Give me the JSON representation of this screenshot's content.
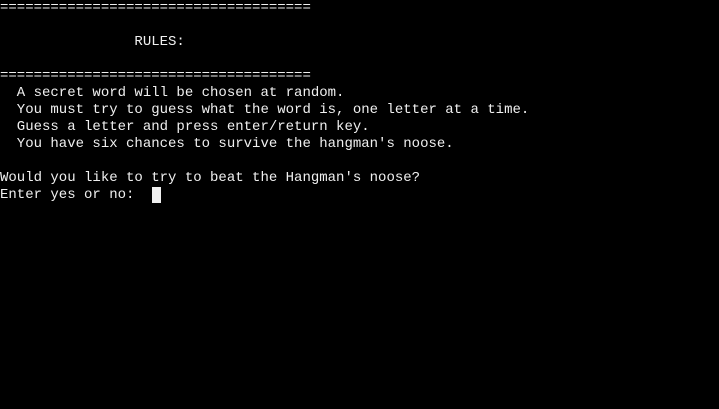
{
  "terminal": {
    "top_rule": "=====================================",
    "heading": "                RULES:",
    "bottom_rule": "=====================================",
    "rules": [
      "  A secret word will be chosen at random.",
      "  You must try to guess what the word is, one letter at a time.",
      "  Guess a letter and press enter/return key.",
      "  You have six chances to survive the hangman's noose."
    ],
    "question": "Would you like to try to beat the Hangman's noose?",
    "prompt": "Enter yes or no: "
  },
  "colors": {
    "background": "#000000",
    "text": "#f0f0f0"
  }
}
